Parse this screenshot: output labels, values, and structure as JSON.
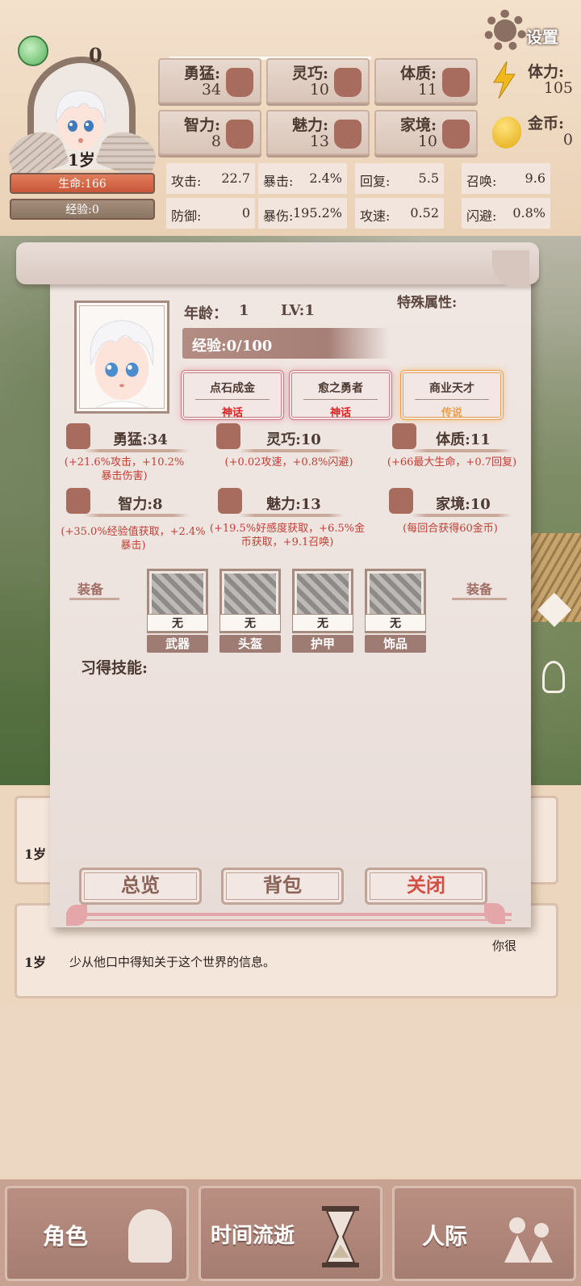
{
  "header": {
    "top_counter": "0",
    "age_badge": "1岁",
    "hp": "生命:166",
    "xp": "经验:0",
    "settings": "设置",
    "attributes": [
      {
        "label": "勇猛:",
        "value": "34",
        "icon": "fist-icon"
      },
      {
        "label": "灵巧:",
        "value": "10",
        "icon": "cloth-icon"
      },
      {
        "label": "体质:",
        "value": "11",
        "icon": "muscle-arm-icon"
      },
      {
        "label": "智力:",
        "value": "8",
        "icon": "brain-head-icon"
      },
      {
        "label": "魅力:",
        "value": "13",
        "icon": "flower-bud-icon"
      },
      {
        "label": "家境:",
        "value": "10",
        "icon": "coin-hand-icon"
      }
    ],
    "stamina": {
      "label": "体力:",
      "value": "105"
    },
    "gold": {
      "label": "金币:",
      "value": "0"
    },
    "combat": [
      {
        "name": "攻击:",
        "value": "22.7"
      },
      {
        "name": "暴击:",
        "value": "2.4%"
      },
      {
        "name": "回复:",
        "value": "5.5"
      },
      {
        "name": "召唤:",
        "value": "9.6"
      },
      {
        "name": "防御:",
        "value": "0"
      },
      {
        "name": "暴伤:",
        "value": "195.2%"
      },
      {
        "name": "攻速:",
        "value": "0.52"
      },
      {
        "name": "闪避:",
        "value": "0.8%"
      }
    ]
  },
  "panel": {
    "age_label": "年龄：",
    "age_value": "1",
    "level": "LV:1",
    "special_label": "特殊属性:",
    "xp": "经验:0/100",
    "traits": [
      {
        "name": "点石成金",
        "rank": "神话"
      },
      {
        "name": "愈之勇者",
        "rank": "神话"
      },
      {
        "name": "商业天才",
        "rank": "传说"
      }
    ],
    "attrs": [
      {
        "title": "勇猛:34",
        "desc": "(+21.6%攻击，+10.2%暴击伤害)"
      },
      {
        "title": "灵巧:10",
        "desc": "(+0.02攻速，+0.8%闪避)"
      },
      {
        "title": "体质:11",
        "desc": "(+66最大生命，+0.7回复)"
      },
      {
        "title": "智力:8",
        "desc": "(+35.0%经验值获取，+2.4%暴击)"
      },
      {
        "title": "魅力:13",
        "desc": "(+19.5%好感度获取，+6.5%金币获取，+9.1召唤)"
      },
      {
        "title": "家境:10",
        "desc": "(每回合获得60金币)"
      }
    ],
    "equip_label_left": "装备",
    "equip_label_right": "装备",
    "slots": [
      {
        "state": "无",
        "name": "武器"
      },
      {
        "state": "无",
        "name": "头盔"
      },
      {
        "state": "无",
        "name": "护甲"
      },
      {
        "state": "无",
        "name": "饰品"
      }
    ],
    "skills_label": "习得技能:",
    "buttons": {
      "overview": "总览",
      "bag": "背包",
      "close": "关闭"
    }
  },
  "log": [
    {
      "age": "1岁",
      "text": ""
    },
    {
      "age": "1岁",
      "text": "少从他口中得知关于这个世界的信息。",
      "text_right": "你很"
    }
  ],
  "nav": [
    {
      "label": "角色",
      "icon": "character-bust-icon"
    },
    {
      "label": "时间流逝",
      "icon": "hourglass-icon"
    },
    {
      "label": "人际",
      "icon": "people-icon"
    }
  ],
  "colors": {
    "hp": "#c9573a",
    "myth": "#e01f1f",
    "legend": "#e9a149",
    "attr_desc": "#c23e34"
  }
}
